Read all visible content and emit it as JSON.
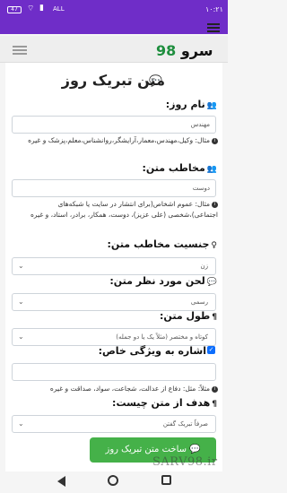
{
  "status": {
    "time": "۱۰:۲۱",
    "battery": "47",
    "carrier": "ALL"
  },
  "brand": {
    "name": "سرو",
    "number": "98"
  },
  "title": "متن تبریک روز",
  "form": {
    "day_name": {
      "label": "نام روز:",
      "value": "مهندس",
      "help": "مثال: وکیل،مهندس،معمار،آرایشگر،روانشناس،معلم،پزشک و غیره"
    },
    "audience": {
      "label": "مخاطب متن:",
      "value": "دوست",
      "help": "مثال: عموم اشخاص(برای انتشار در سایت یا شبکه‌های اجتماعی)،شخصی (علی عزیز)، دوست، همکار، برادر، استاد، و غیره"
    },
    "gender": {
      "label": "جنسیت مخاطب متن:",
      "selected": "زن"
    },
    "tone": {
      "label": "لحن مورد نظر متن:",
      "selected": "رسمی"
    },
    "length": {
      "label": "طول متن:",
      "selected": "کوتاه و مختصر (مثلاً یک یا دو جمله)"
    },
    "feature": {
      "label": "اشاره به ویژگی خاص:",
      "checked": true,
      "value": "",
      "help": "مثلاً: مثل: دفاع از عدالت، شجاعت، سواد، صداقت و غیره"
    },
    "purpose": {
      "label": "هدف از متن چیست:",
      "selected": "صرفاً تبریک گفتن"
    },
    "submit_label": "ساخت متن تبریک روز"
  },
  "watermark": "SARV98.ir"
}
